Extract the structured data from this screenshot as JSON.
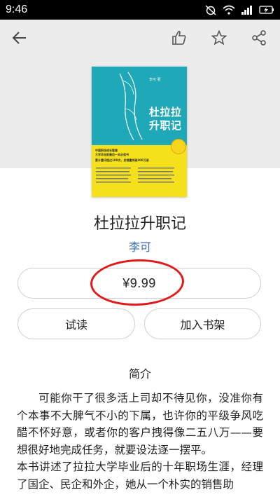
{
  "status_bar": {
    "time": "9:46"
  },
  "book": {
    "title": "杜拉拉升职记",
    "author": "李可",
    "price": "¥9.99",
    "cover": {
      "title": "杜拉拉升职记",
      "author_line": "李可 著",
      "line_1": "中国职场成长智慧",
      "line_2": "大学毕业前最后一本必读书",
      "line_3": "累计重印超过100次，总销量突破300万册"
    }
  },
  "actions": {
    "try_read_label": "试读",
    "add_shelf_label": "加入书架"
  },
  "intro": {
    "title": "简介",
    "paragraph_1": "可能你干了很多活上司却不待见你，没准你有个本事不大脾气不小的下属，也许你的平级争风吃醋不怀好意，或者你的客户拽得像二五八万——要想很好地完成任务，就要设法逐一摆平。",
    "paragraph_2": "本书讲述了拉拉大学毕业后的十年职场生涯，经理了国企、民企和外企，她从一个朴实的销售助"
  },
  "colors": {
    "accent": "#3a6bb0",
    "highlight": "#e21a1a",
    "cover_teal": "#1fa9b8",
    "cover_yellow": "#f4e11c"
  },
  "icons": [
    "wifi-icon",
    "signal-icon",
    "battery-icon",
    "back-arrow-icon",
    "thumbs-up-icon",
    "star-icon",
    "share-icon"
  ]
}
